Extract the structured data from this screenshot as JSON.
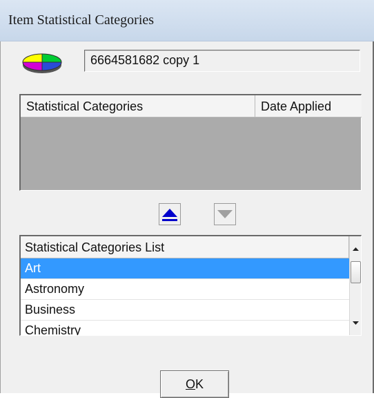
{
  "window": {
    "title": "Item Statistical Categories"
  },
  "item": {
    "icon": "pie-chart-icon",
    "value": "6664581682 copy 1"
  },
  "applied_list": {
    "columns": [
      "Statistical Categories",
      "Date Applied"
    ],
    "rows": []
  },
  "move_buttons": {
    "up_icon": "up-arrow-icon",
    "down_icon": "down-arrow-icon"
  },
  "categories_list": {
    "header": "Statistical Categories List",
    "items": [
      "Art",
      "Astronomy",
      "Business",
      "Chemistry"
    ],
    "selected": "Art"
  },
  "ok_button": {
    "mnemonic": "O",
    "rest": "K"
  },
  "colors": {
    "selection": "#3399ff",
    "arrow_active": "#0000cc",
    "empty_list_bg": "#ababab"
  }
}
